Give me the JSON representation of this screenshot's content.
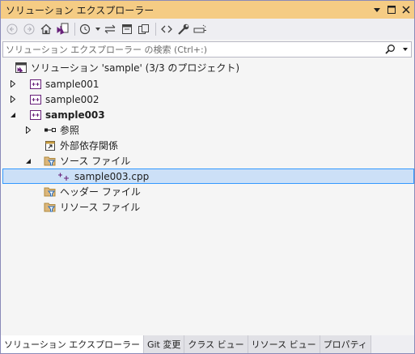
{
  "window": {
    "title": "ソリューション エクスプローラー",
    "accent": "#f5cc84",
    "controls": [
      "dropdown-icon",
      "maximize-icon",
      "close-icon"
    ]
  },
  "toolbar": {
    "buttons": [
      "back-icon",
      "forward-icon",
      "home-icon",
      "vs-switch-views-icon",
      "history-icon",
      "sync-icon",
      "collapse-all-icon",
      "show-all-files-icon",
      "code-view-icon",
      "properties-icon",
      "preview-icon"
    ]
  },
  "search": {
    "placeholder": "ソリューション エクスプローラー の検索 (Ctrl+:)"
  },
  "tree": {
    "solution": "ソリューション 'sample' (3/3 のプロジェクト)",
    "projects": [
      "sample001",
      "sample002",
      "sample003"
    ],
    "references": "参照",
    "external_deps": "外部依存関係",
    "source_files": "ソース ファイル",
    "source_file_item": "sample003.cpp",
    "header_files": "ヘッダー ファイル",
    "resource_files": "リソース ファイル"
  },
  "tabs": [
    {
      "label": "ソリューション エクスプローラー",
      "active": true
    },
    {
      "label": "Git 変更",
      "active": false
    },
    {
      "label": "クラス ビュー",
      "active": false
    },
    {
      "label": "リソース ビュー",
      "active": false
    },
    {
      "label": "プロパティ",
      "active": false
    }
  ]
}
